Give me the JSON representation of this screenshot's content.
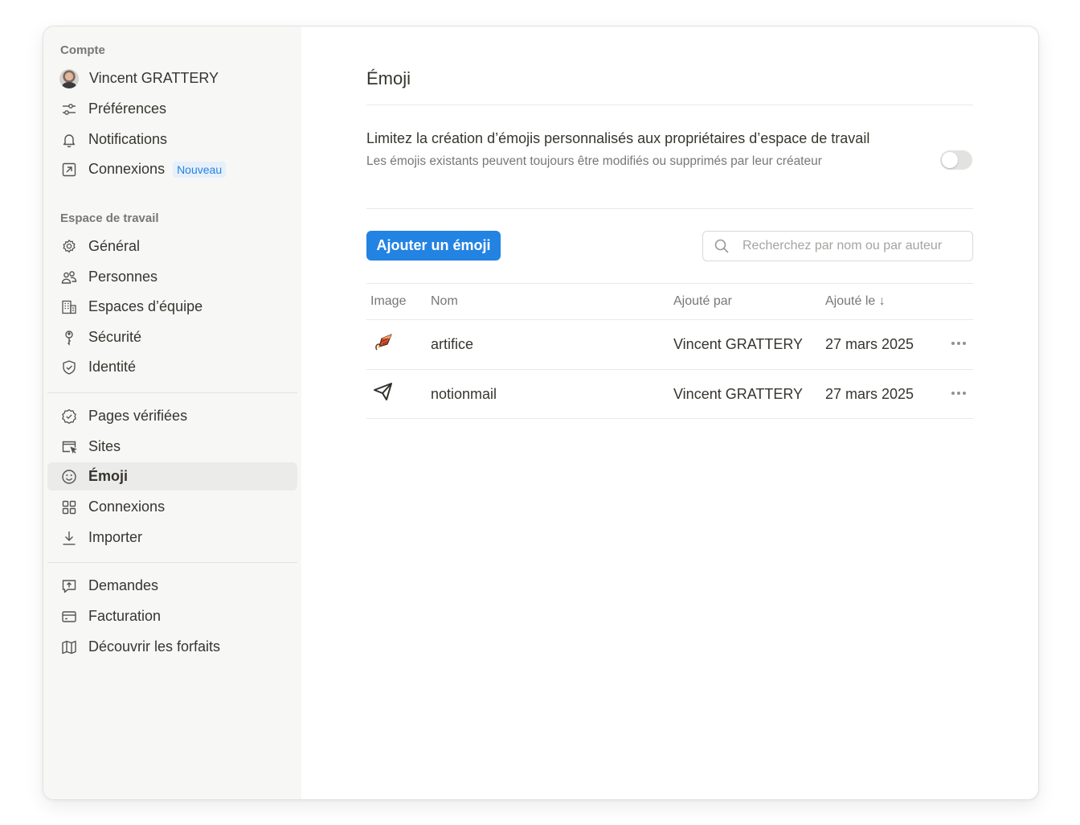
{
  "sidebar": {
    "account_label": "Compte",
    "user_name": "Vincent GRATTERY",
    "account_items": [
      {
        "label": "Préférences",
        "icon": "sliders-icon"
      },
      {
        "label": "Notifications",
        "icon": "bell-icon"
      },
      {
        "label": "Connexions",
        "icon": "external-link-icon",
        "badge": "Nouveau"
      }
    ],
    "workspace_label": "Espace de travail",
    "workspace_items": [
      {
        "label": "Général",
        "icon": "gear-icon"
      },
      {
        "label": "Personnes",
        "icon": "people-icon"
      },
      {
        "label": "Espaces d’équipe",
        "icon": "building-icon"
      },
      {
        "label": "Sécurité",
        "icon": "key-icon"
      },
      {
        "label": "Identité",
        "icon": "shield-check-icon"
      }
    ],
    "feature_items": [
      {
        "label": "Pages vérifiées",
        "icon": "verified-badge-icon"
      },
      {
        "label": "Sites",
        "icon": "browser-cursor-icon"
      },
      {
        "label": "Émoji",
        "icon": "smiley-icon",
        "active": true
      },
      {
        "label": "Connexions",
        "icon": "grid-icon"
      },
      {
        "label": "Importer",
        "icon": "download-icon"
      }
    ],
    "billing_items": [
      {
        "label": "Demandes",
        "icon": "request-icon"
      },
      {
        "label": "Facturation",
        "icon": "credit-card-icon"
      },
      {
        "label": "Découvrir les forfaits",
        "icon": "map-icon"
      }
    ]
  },
  "main": {
    "title": "Émoji",
    "setting": {
      "title": "Limitez la création d’émojis personnalisés aux propriétaires d’espace de travail",
      "description": "Les émojis existants peuvent toujours être modifiés ou supprimés par leur créateur",
      "enabled": false
    },
    "add_button": "Ajouter un émoji",
    "search_placeholder": "Recherchez par nom ou par auteur",
    "table": {
      "headers": {
        "image": "Image",
        "name": "Nom",
        "added_by": "Ajouté par",
        "added_on": "Ajouté le ↓"
      },
      "rows": [
        {
          "image": "firework-icon",
          "name": "artifice",
          "added_by": "Vincent GRATTERY",
          "added_on": "27 mars 2025"
        },
        {
          "image": "paper-plane-icon",
          "name": "notionmail",
          "added_by": "Vincent GRATTERY",
          "added_on": "27 mars 2025"
        }
      ]
    }
  },
  "colors": {
    "accent": "#2383e2",
    "sidebar_bg": "#f7f7f5",
    "active_bg": "#ebebea"
  }
}
